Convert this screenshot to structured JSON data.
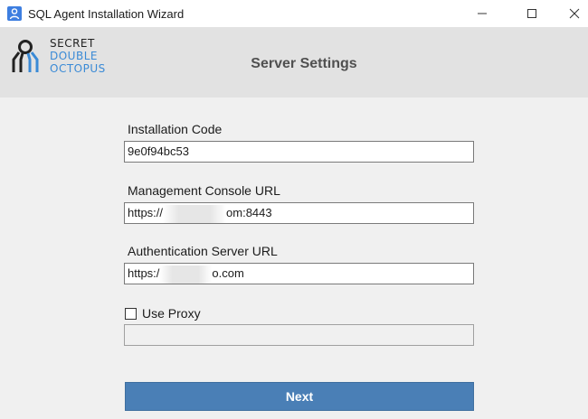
{
  "window": {
    "title": "SQL Agent Installation Wizard"
  },
  "header": {
    "logo_line1": "SECRET",
    "logo_line2": "DOUBLE",
    "logo_line3": "OCTOPUS",
    "title": "Server Settings"
  },
  "form": {
    "installation_code": {
      "label": "Installation Code",
      "value": "9e0f94bc53"
    },
    "console_url": {
      "label": "Management Console URL",
      "value_prefix": "https://",
      "value_suffix": "om:8443"
    },
    "auth_url": {
      "label": "Authentication Server URL",
      "value_prefix": "https:/",
      "value_suffix": "o.com"
    },
    "use_proxy": {
      "label": "Use Proxy",
      "checked": false,
      "value": ""
    }
  },
  "actions": {
    "next_label": "Next"
  },
  "colors": {
    "accent": "#4a7fb6",
    "logo_blue": "#3a8ad6"
  }
}
